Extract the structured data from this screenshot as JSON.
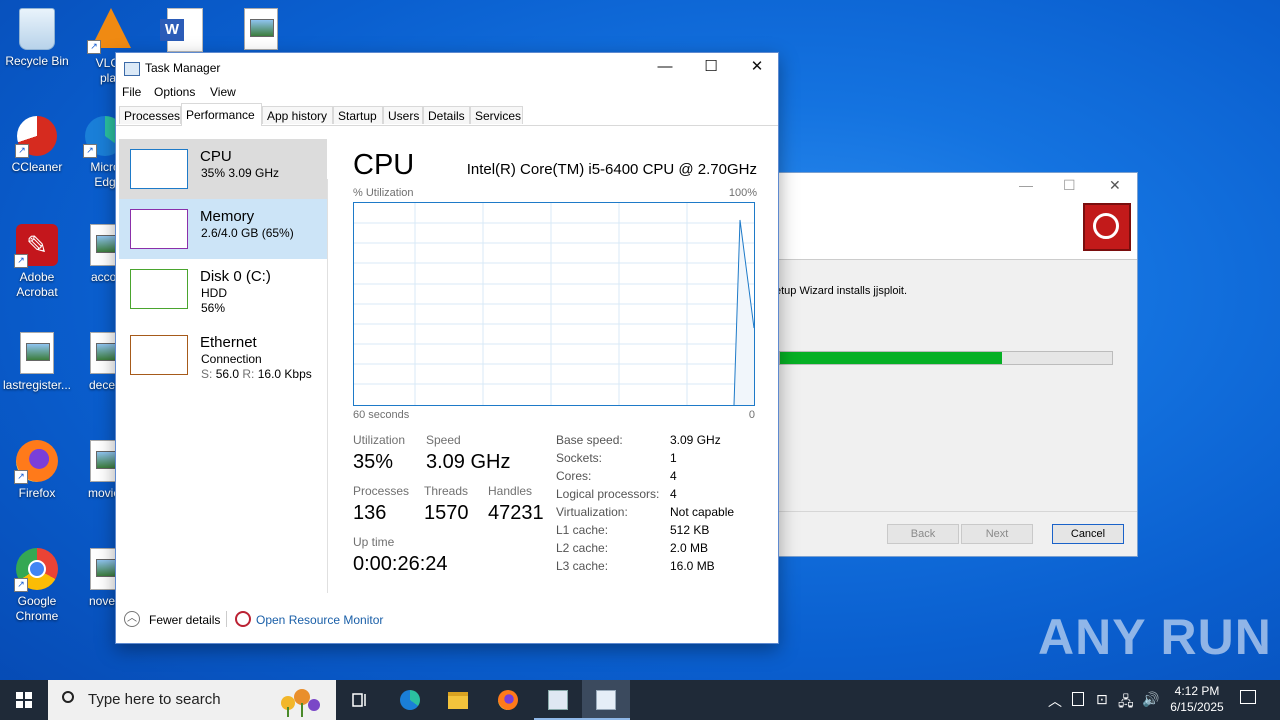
{
  "desktop": {
    "icons": [
      {
        "label": "Recycle Bin"
      },
      {
        "label": "VLC r… play…",
        "line1": "VLC r",
        "line2": "play"
      },
      {
        "label": ""
      },
      {
        "label": ""
      },
      {
        "label": "CCleaner"
      },
      {
        "label": "Micro Edg",
        "line1": "Micro",
        "line2": "Edg"
      },
      {
        "label": "Adobe Acrobat",
        "line1": "Adobe",
        "line2": "Acrobat"
      },
      {
        "label": "accou"
      },
      {
        "label": "lastregister..."
      },
      {
        "label": "decem"
      },
      {
        "label": "Firefox"
      },
      {
        "label": "movies"
      },
      {
        "label": "Google Chrome",
        "line1": "Google",
        "line2": "Chrome"
      },
      {
        "label": "novem"
      }
    ],
    "watermark": "ANY RUN"
  },
  "installer": {
    "message": "etup Wizard installs jjsploit.",
    "progress": 0.67,
    "buttons": {
      "back": "Back",
      "next": "Next",
      "cancel": "Cancel"
    },
    "controls": {
      "minimize": "—",
      "maximize": "☐",
      "close": "✕"
    }
  },
  "taskmanager": {
    "title": "Task Manager",
    "controls": {
      "minimize": "—",
      "maximize": "☐",
      "close": "✕"
    },
    "menu": [
      "File",
      "Options",
      "View"
    ],
    "tabs": [
      "Processes",
      "Performance",
      "App history",
      "Startup",
      "Users",
      "Details",
      "Services"
    ],
    "active_tab": "Performance",
    "sidebar": [
      {
        "name": "CPU",
        "sub1": "35%  3.09 GHz",
        "color": "#1e7ac8"
      },
      {
        "name": "Memory",
        "sub1": "2.6/4.0 GB (65%)",
        "color": "#8b2faa"
      },
      {
        "name": "Disk 0 (C:)",
        "sub1": "HDD",
        "sub2": "56%",
        "color": "#4aa52e"
      },
      {
        "name": "Ethernet",
        "sub1": "Connection",
        "sub2_s": "S:",
        "sub2_sv": "56.0",
        "sub2_r": "R:",
        "sub2_rv": "16.0 Kbps",
        "color": "#a65a1a"
      }
    ],
    "main": {
      "heading": "CPU",
      "cpu_model": "Intel(R) Core(TM) i5-6400 CPU @ 2.70GHz",
      "graph_top_left": "% Utilization",
      "graph_top_right": "100%",
      "graph_bottom_left": "60 seconds",
      "graph_bottom_right": "0",
      "stats": {
        "utilization_label": "Utilization",
        "utilization": "35%",
        "speed_label": "Speed",
        "speed": "3.09 GHz",
        "processes_label": "Processes",
        "processes": "136",
        "threads_label": "Threads",
        "threads": "1570",
        "handles_label": "Handles",
        "handles": "47231",
        "uptime_label": "Up time",
        "uptime": "0:00:26:24"
      },
      "details": [
        {
          "k": "Base speed:",
          "v": "3.09 GHz"
        },
        {
          "k": "Sockets:",
          "v": "1"
        },
        {
          "k": "Cores:",
          "v": "4"
        },
        {
          "k": "Logical processors:",
          "v": "4"
        },
        {
          "k": "Virtualization:",
          "v": "Not capable"
        },
        {
          "k": "L1 cache:",
          "v": "512 KB"
        },
        {
          "k": "L2 cache:",
          "v": "2.0 MB"
        },
        {
          "k": "L3 cache:",
          "v": "16.0 MB"
        }
      ]
    },
    "footer": {
      "fewer_details": "Fewer details",
      "resource_monitor": "Open Resource Monitor"
    }
  },
  "taskbar": {
    "search_placeholder": "Type here to search",
    "time": "4:12 PM",
    "date": "6/15/2025"
  }
}
